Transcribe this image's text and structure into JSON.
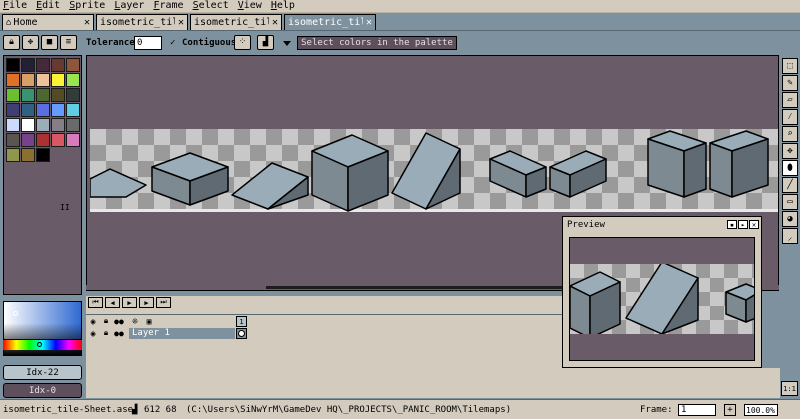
{
  "menu": [
    "File",
    "Edit",
    "Sprite",
    "Layer",
    "Frame",
    "Select",
    "View",
    "Help"
  ],
  "tabs": [
    {
      "label": "Home",
      "close": "✕"
    },
    {
      "label": "isometric_tile.a",
      "close": "✕"
    },
    {
      "label": "isometric_tile-S",
      "close": "✕"
    },
    {
      "label": "isometric_tile-S",
      "close": "✕"
    }
  ],
  "contextbar": {
    "tolerance_label": "Tolerance:",
    "tolerance_value": "0",
    "contiguous_label": "Contiguous",
    "contiguous_check": "✓",
    "select_colors_label": "Select colors in the palette"
  },
  "palette": {
    "colors": [
      "#000000",
      "#222034",
      "#45283c",
      "#663931",
      "#8f563b",
      "#df7126",
      "#d9a066",
      "#eec39a",
      "#fbf236",
      "#99e550",
      "#6abe30",
      "#37946e",
      "#4b692f",
      "#524b24",
      "#323c39",
      "#3f3f74",
      "#306082",
      "#5b6ee1",
      "#639bff",
      "#5fcde4",
      "#cbdbfc",
      "#ffffff",
      "#9badb7",
      "#847e87",
      "#696a6a",
      "#595652",
      "#76428a",
      "#ac3232",
      "#d95763",
      "#d77bba",
      "#8f974a",
      "#8a6f30",
      "#000000"
    ],
    "more_indicator": "II"
  },
  "color_fg": {
    "label": "Idx-22"
  },
  "color_bg": {
    "label": "Idx-0"
  },
  "preview": {
    "title": "Preview"
  },
  "timeline": {
    "layer_name": "Layer 1",
    "frame_number": "1"
  },
  "status": {
    "filename": "isometric_tile-Sheet.ase",
    "size": "612 68",
    "path": "(C:\\Users\\SiNwYrM\\GameDev HQ\\_PROJECTS\\_PANIC_ROOM\\Tilemaps)",
    "frame_label": "Frame:",
    "frame_value": "1",
    "zoom_value": "100.0%"
  },
  "pixel_ratio": "1:1",
  "colors": {
    "chrome": "#d3cbbe",
    "workspace": "#7d929e",
    "canvas_bg": "#6a5b68",
    "tile_fill": "#9aacb7",
    "tile_shade": "#5f6a72"
  }
}
